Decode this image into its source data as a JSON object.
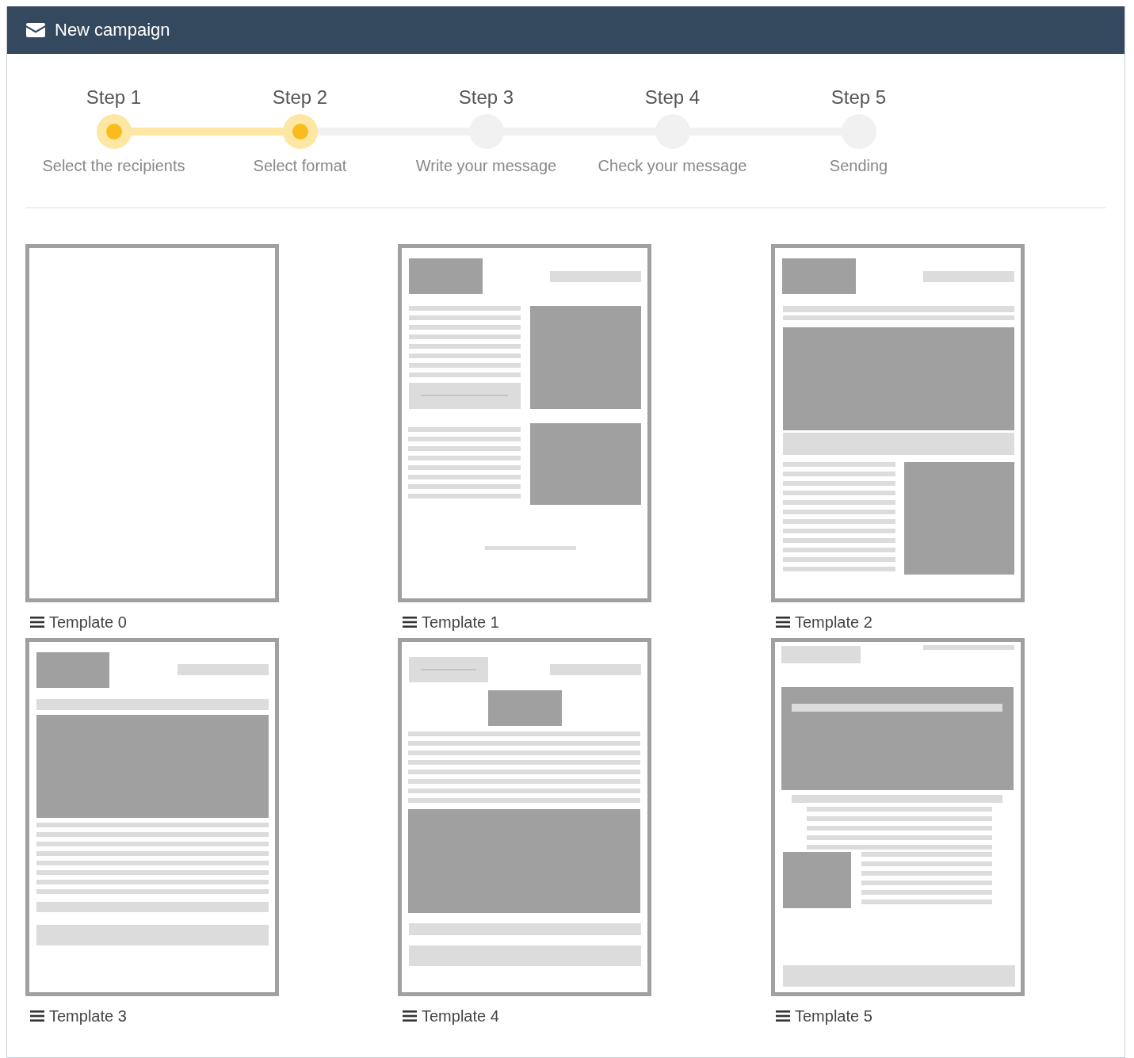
{
  "header": {
    "title": "New campaign"
  },
  "steps": [
    {
      "label": "Step 1",
      "description": "Select the recipients",
      "completed": true
    },
    {
      "label": "Step 2",
      "description": "Select format",
      "completed": true
    },
    {
      "label": "Step 3",
      "description": "Write your message",
      "completed": false
    },
    {
      "label": "Step 4",
      "description": "Check your message",
      "completed": false
    },
    {
      "label": "Step 5",
      "description": "Sending",
      "completed": false
    }
  ],
  "templates": [
    {
      "name": "Template 0",
      "kind": "blank"
    },
    {
      "name": "Template 1",
      "kind": "sidebar"
    },
    {
      "name": "Template 2",
      "kind": "hero-split"
    },
    {
      "name": "Template 3",
      "kind": "hero"
    },
    {
      "name": "Template 4",
      "kind": "centered"
    },
    {
      "name": "Template 5",
      "kind": "banner"
    }
  ]
}
